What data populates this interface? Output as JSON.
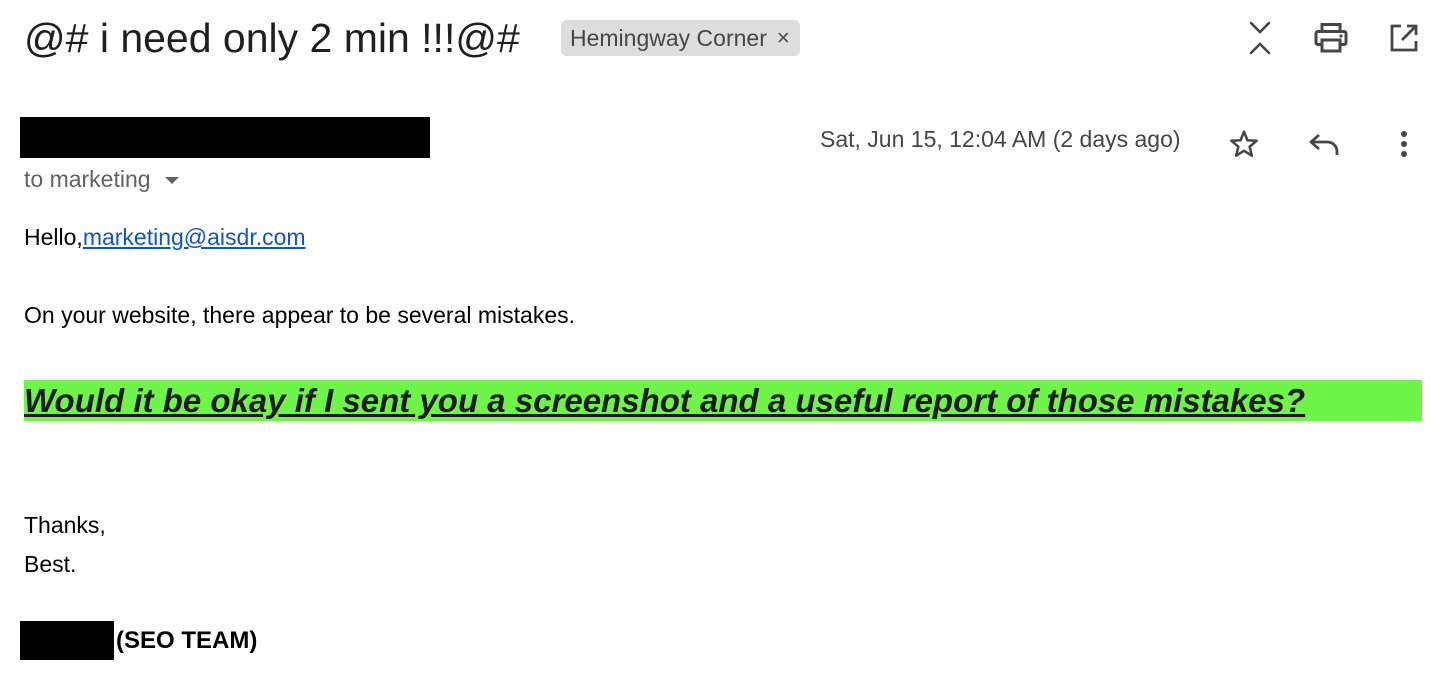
{
  "email": {
    "subject": "@# i need only 2 min !!!@#",
    "label": "Hemingway Corner",
    "label_close": "×",
    "date": "Sat, Jun 15, 12:04 AM (2 days ago)",
    "recipient": "to marketing",
    "greeting_prefix": "Hello,",
    "greeting_email": "marketing@aisdr.com",
    "line1": "On your website, there appear to be several mistakes.",
    "highlight": "Would it be okay if I sent you a screenshot and a useful report of those mistakes?",
    "closing1": "Thanks,",
    "closing2": "Best.",
    "signature_team": "(SEO TEAM)"
  },
  "icons": {
    "expand": "expand-collapse-icon",
    "print": "print-icon",
    "open_new": "open-in-new-window-icon",
    "star": "star-icon",
    "reply": "reply-icon",
    "more": "more-vertical-icon"
  },
  "colors": {
    "highlight_bg": "#6ff44a",
    "link": "#1155cc",
    "chip_bg": "#dddddd",
    "secondary_text": "#444746"
  }
}
